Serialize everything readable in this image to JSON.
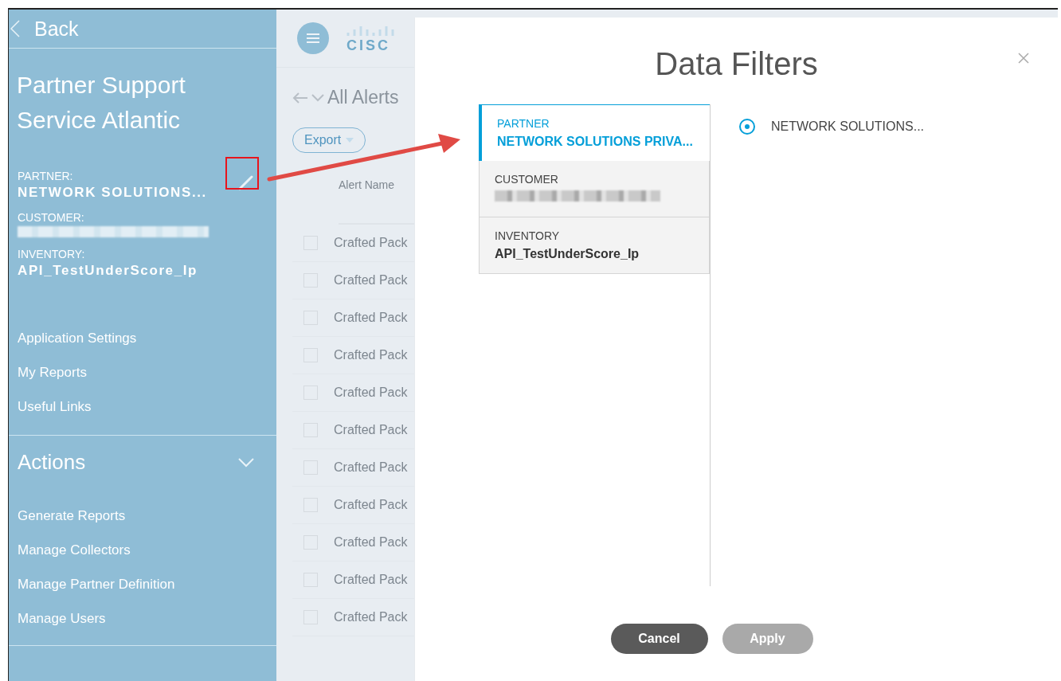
{
  "sidebar": {
    "back": "Back",
    "title": "Partner Support Service Atlantic",
    "filters": [
      {
        "label": "PARTNER:",
        "value": "NETWORK SOLUTIONS..."
      },
      {
        "label": "CUSTOMER:",
        "redacted": true
      },
      {
        "label": "INVENTORY:",
        "value": "API_TestUnderScore_Ip"
      }
    ],
    "menu": [
      "Application Settings",
      "My Reports",
      "Useful Links"
    ],
    "section": {
      "title": "Actions",
      "expanded": true
    },
    "actions": [
      "Generate Reports",
      "Manage Collectors",
      "Manage Partner Definition",
      "Manage Users"
    ]
  },
  "main": {
    "logo": "CISC",
    "title": "All Alerts",
    "export": "Export",
    "column": "Alert Name",
    "rows": [
      {
        "text": "Crafted Pack",
        "checked": false
      },
      {
        "text": "Crafted Pack",
        "checked": false
      },
      {
        "text": "Crafted Pack",
        "checked": false
      },
      {
        "text": "Crafted Pack",
        "checked": false
      },
      {
        "text": "Crafted Pack",
        "checked": false
      },
      {
        "text": "Crafted Pack",
        "checked": false
      },
      {
        "text": "Crafted Pack",
        "checked": false
      },
      {
        "text": "Crafted Pack",
        "checked": false
      },
      {
        "text": "Crafted Pack",
        "checked": false
      },
      {
        "text": "Crafted Pack",
        "checked": false
      },
      {
        "text": "Crafted Pack",
        "checked": false
      }
    ]
  },
  "dialog": {
    "title": "Data Filters",
    "tabs": [
      {
        "label": "PARTNER",
        "value": "NETWORK SOLUTIONS PRIVA...",
        "redacted": false,
        "selected": true
      },
      {
        "label": "CUSTOMER",
        "redacted": true,
        "selected": false
      },
      {
        "label": "INVENTORY",
        "value": "API_TestUnderScore_Ip",
        "redacted": false,
        "selected": false
      }
    ],
    "options": [
      {
        "label": "NETWORK SOLUTIONS...",
        "selected": true
      }
    ],
    "buttons": [
      {
        "label": "Cancel",
        "disabled": false
      },
      {
        "label": "Apply",
        "disabled": true
      }
    ]
  }
}
